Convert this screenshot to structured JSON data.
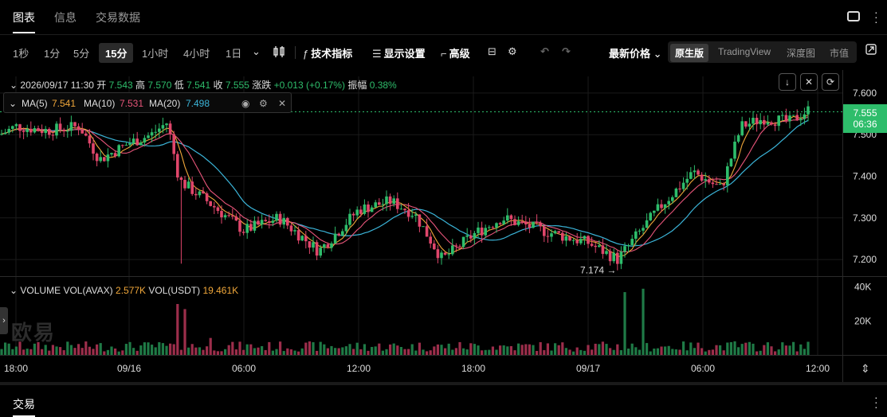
{
  "tabs": [
    "图表",
    "信息",
    "交易数据"
  ],
  "timeframes": [
    "1秒",
    "1分",
    "5分",
    "15分",
    "1小时",
    "4小时",
    "1日"
  ],
  "active_timeframe_index": 3,
  "tools": {
    "indicators": "技术指标",
    "display": "显示设置",
    "advanced": "高级"
  },
  "price_mode": "最新价格",
  "view_modes": [
    "原生版",
    "TradingView",
    "深度图",
    "市值"
  ],
  "ohlc": {
    "time": "2026/09/17 11:30",
    "open_label": "开",
    "open": "7.543",
    "high_label": "高",
    "high": "7.570",
    "low_label": "低",
    "low": "7.541",
    "close_label": "收",
    "close": "7.555",
    "change_label": "涨跌",
    "change": "+0.013 (+0.17%)",
    "amp_label": "振幅",
    "amp": "0.38%"
  },
  "ma": {
    "ma5_label": "MA(5)",
    "ma5": "7.541",
    "ma10_label": "MA(10)",
    "ma10": "7.531",
    "ma20_label": "MA(20)",
    "ma20": "7.498"
  },
  "volume": {
    "label": "VOLUME",
    "vol_avax_label": "VOL(AVAX)",
    "vol_avax": "2.577K",
    "vol_usdt_label": "VOL(USDT)",
    "vol_usdt": "19.461K"
  },
  "price_axis": [
    "7.600",
    "7.500",
    "7.400",
    "7.300",
    "7.200"
  ],
  "volume_axis": [
    "40K",
    "20K"
  ],
  "time_axis": [
    "18:00",
    "09/16",
    "06:00",
    "12:00",
    "18:00",
    "09/17",
    "06:00",
    "12:00"
  ],
  "current_price": "7.555",
  "countdown": "06:36",
  "low_marker": "7.174 →",
  "watermark": "欧易",
  "bottom_tab": "交易",
  "colors": {
    "up": "#2ebd6b",
    "down": "#e0466b",
    "ma5": "#f0a73a",
    "ma10": "#e8557a",
    "ma20": "#3bb4d8"
  },
  "chart_data": {
    "type": "candlestick",
    "x": [
      "09/15 18:00",
      "09/16 00:00",
      "09/16 06:00",
      "09/16 12:00",
      "09/16 18:00",
      "09/17 00:00",
      "09/17 06:00",
      "09/17 11:30"
    ],
    "close": [
      7.52,
      7.52,
      7.29,
      7.31,
      7.25,
      7.23,
      7.42,
      7.555
    ],
    "ylim": [
      7.16,
      7.64
    ],
    "volume_ylim": [
      0,
      45000
    ]
  }
}
